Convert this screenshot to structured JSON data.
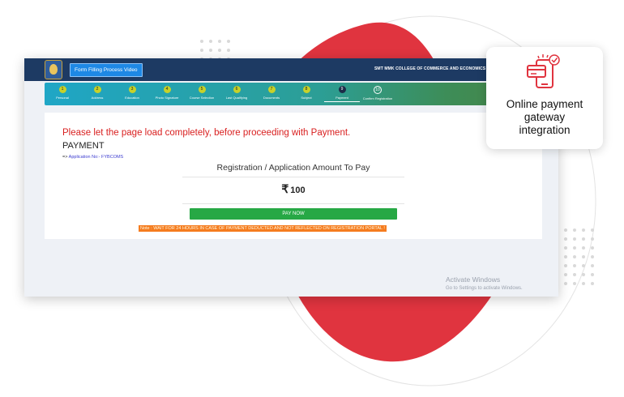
{
  "header": {
    "video_button": "Form Filling Process Video",
    "college_name": "SMT MMK COLLEGE OF COMMERCE AND ECONOMICS"
  },
  "steps": [
    {
      "num": "1",
      "label": "Personal"
    },
    {
      "num": "2",
      "label": "Address"
    },
    {
      "num": "3",
      "label": "Education"
    },
    {
      "num": "4",
      "label": "Photo Signature"
    },
    {
      "num": "5",
      "label": "Course Selection"
    },
    {
      "num": "6",
      "label": "Last Qualifying"
    },
    {
      "num": "7",
      "label": "Documents"
    },
    {
      "num": "8",
      "label": "Subject"
    },
    {
      "num": "9",
      "label": "Payment"
    },
    {
      "num": "10",
      "label": "Confirm Registration"
    }
  ],
  "payment": {
    "warning": "Please let the page load completely, before proceeding with Payment.",
    "title": "PAYMENT",
    "app_arrow": "=>",
    "app_no": "Application No:- FYBCOMS",
    "amount_label": "Registration / Application Amount To Pay",
    "currency": "₹",
    "amount": "100",
    "pay_button": "PAY NOW",
    "note": "Note : WAIT FOR 24 HOURS IN CASE OF PAYMENT DEDUCTED AND NOT REFLECTED ON REGISTRATION PORTAL !"
  },
  "watermark": {
    "line1": "Activate Windows",
    "line2": "Go to Settings to activate Windows."
  },
  "callout": {
    "line1": "Online payment",
    "line2": "gateway",
    "line3": "integration"
  },
  "colors": {
    "blob": "#e0343f",
    "header": "#1d3a63",
    "pay_button": "#27a845",
    "warning": "#d91f1f",
    "note_bg": "#f57c1f"
  }
}
